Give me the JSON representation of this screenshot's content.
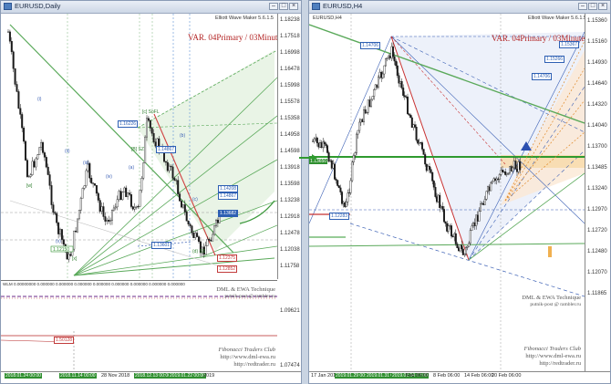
{
  "left_window": {
    "title": "EURUSD,Daily",
    "indicator_name": "Elliott Wave Maker 5.6.1.5",
    "annotation": "VAR. 04Primary / 03Minute",
    "price_axis": [
      "1.18238",
      "1.17518",
      "1.16998",
      "1.16478",
      "1.15998",
      "1.15578",
      "1.15358",
      "1.14958",
      "1.14598",
      "1.13918",
      "1.13598",
      "1.13238",
      "1.12918",
      "1.12478",
      "1.12038",
      "1.11758"
    ],
    "price_boxes": [
      "1.16226",
      "1.14867",
      "1.13682",
      "1.14208",
      "1.13601",
      "1.12375",
      "1.12852",
      "1.12150"
    ],
    "wave_labels": [
      "[c] SoFL",
      "[B] SZ",
      "(i)",
      "(ii)",
      "(iii)",
      "(iv)",
      "(v)",
      "(a)",
      "(b)",
      "(c)",
      "[x]",
      "[y]",
      "[w]",
      "(d) SS"
    ],
    "indicator_panel_label": "WLM 0.00000000 0.000000 0.000000 0.000000 0.000000 0.000000 0.000000 0.000000 0.000000",
    "indicator_axis": [
      "1.09621",
      "1.07474"
    ],
    "indicator_box": "1.50128",
    "watermark_line1": "DML & EWA Technique",
    "watermark_line2": "putnik-post @ rambler.ru",
    "fib_footer": "Fibonacci   Traders   Club",
    "url1": "http://www.dml-ewa.ru",
    "url2": "http://redtrader.ru",
    "x_labels": [
      "2018.01.24 00:00",
      "2018.11.14 00:00",
      "28 Nov 2018",
      "2018.12.13 00:00",
      "2019.01.10",
      "2019.01.22 00:00",
      "2019"
    ]
  },
  "right_window": {
    "title": "EURUSD,H4",
    "inner_label": "EURUSD,H4",
    "indicator_name": "Elliott Wave Maker 5.6.1.5",
    "annotation": "VAR. 04Primary / 03Minute",
    "price_axis": [
      "1.15360",
      "1.15160",
      "1.14930",
      "1.14640",
      "1.14320",
      "1.14040",
      "1.13700",
      "1.13485",
      "1.13240",
      "1.12970",
      "1.12720",
      "1.12480",
      "1.12070",
      "1.11865"
    ],
    "price_boxes": [
      "1.14706",
      "1.15367",
      "1.15266",
      "1.14126",
      "1.12283",
      "1.13650"
    ],
    "watermark_line1": "DML & EWA Technique",
    "watermark_line2": "putnik-post @ rambler.ru",
    "fib_footer": "Fibonacci   Traders   Club",
    "url1": "http://www.dml-ewa.ru",
    "url2": "http://redtrader.ru",
    "x_labels": [
      "17 Jan 2019",
      "2019.01.29 00:00",
      "2019.01.31 00:00",
      "2019.02.04 00:00",
      "Feb 06:00",
      "8 Feb 06:00",
      "14 Feb 06:00",
      "20 Feb 06:00"
    ]
  },
  "colors": {
    "candle": "#1a1a1a",
    "green": "#3f9a3f",
    "red": "#c83232",
    "blue": "#3a5fb4",
    "orange": "#e08a2a"
  }
}
